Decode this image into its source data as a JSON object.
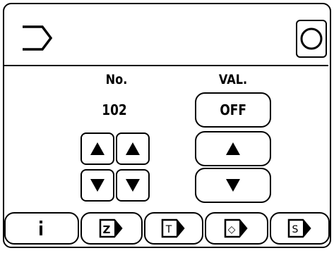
{
  "header": {
    "left_icon": "exit-arrow-icon",
    "right_icon": "circle-o-icon"
  },
  "columns": {
    "no_label": "No.",
    "val_label": "VAL."
  },
  "no": {
    "value": "102"
  },
  "val": {
    "value": "OFF"
  },
  "footer": {
    "tabs": [
      {
        "icon": "info-icon"
      },
      {
        "icon": "z-tab-icon",
        "glyph": "Z"
      },
      {
        "icon": "t-tab-icon",
        "glyph": "T"
      },
      {
        "icon": "diamond-tab-icon",
        "glyph": "◇"
      },
      {
        "icon": "s-tab-icon",
        "glyph": "S"
      }
    ]
  }
}
